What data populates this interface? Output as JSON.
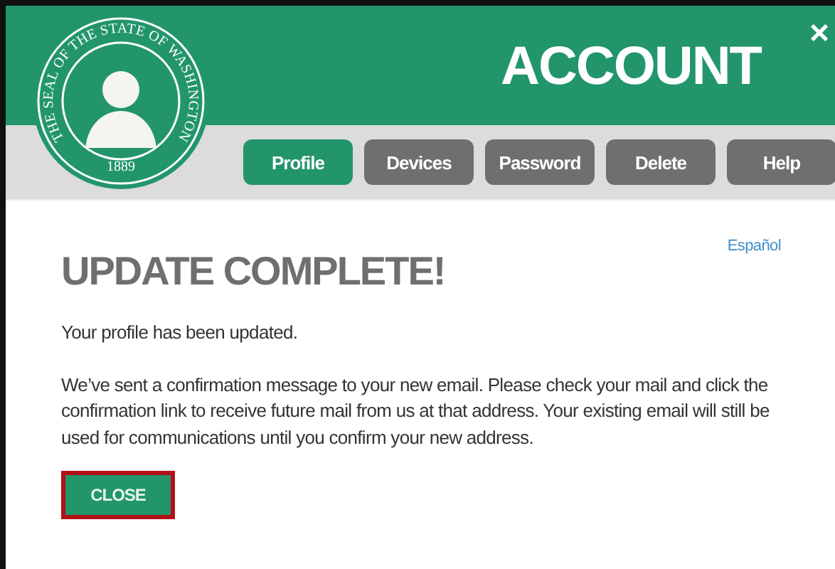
{
  "seal": {
    "text": "THE SEAL OF THE STATE OF WASHINGTON",
    "year": "1889"
  },
  "header": {
    "title": "ACCOUNT",
    "close": "×"
  },
  "tabs": [
    {
      "label": "Profile",
      "selected": true
    },
    {
      "label": "Devices",
      "selected": false
    },
    {
      "label": "Password",
      "selected": false
    },
    {
      "label": "Delete",
      "selected": false
    },
    {
      "label": "Help",
      "selected": false
    }
  ],
  "language_link": "Español",
  "heading": "UPDATE COMPLETE!",
  "paragraphs": [
    "Your profile has been updated.",
    "We’ve sent a confirmation message to your new email. Please check your mail and click the confirmation link to receive future mail from us at that address. Your existing email will still be used for communications until you confirm your new address."
  ],
  "close_button": "CLOSE"
}
